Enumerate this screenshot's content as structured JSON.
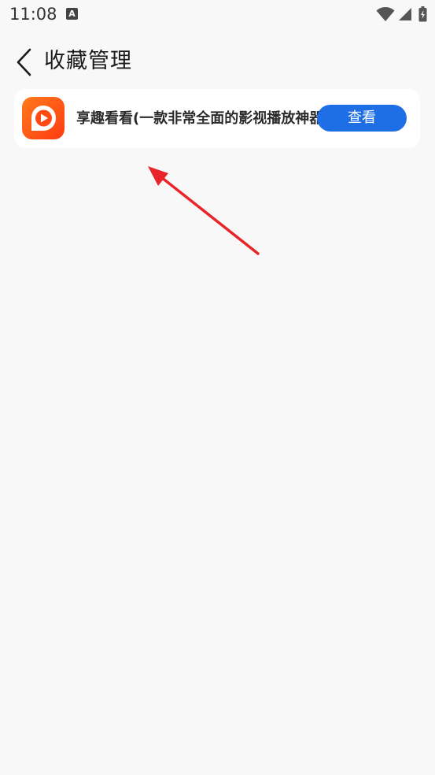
{
  "status_bar": {
    "time": "11:08",
    "notification_icon": "A",
    "icons": [
      "wifi-icon",
      "signal-icon",
      "battery-charging-icon"
    ]
  },
  "header": {
    "back_icon": "chevron-left-icon",
    "title": "收藏管理"
  },
  "favorites": [
    {
      "name": "享趣看看(一款非常全面的影视播放神器",
      "icon": "play-icon",
      "button_label": "查看"
    }
  ],
  "colors": {
    "background": "#f8f8f8",
    "card": "#ffffff",
    "button": "#1e6ee6",
    "app_icon": "#ff5a14",
    "annotation_arrow": "#e8262a"
  }
}
